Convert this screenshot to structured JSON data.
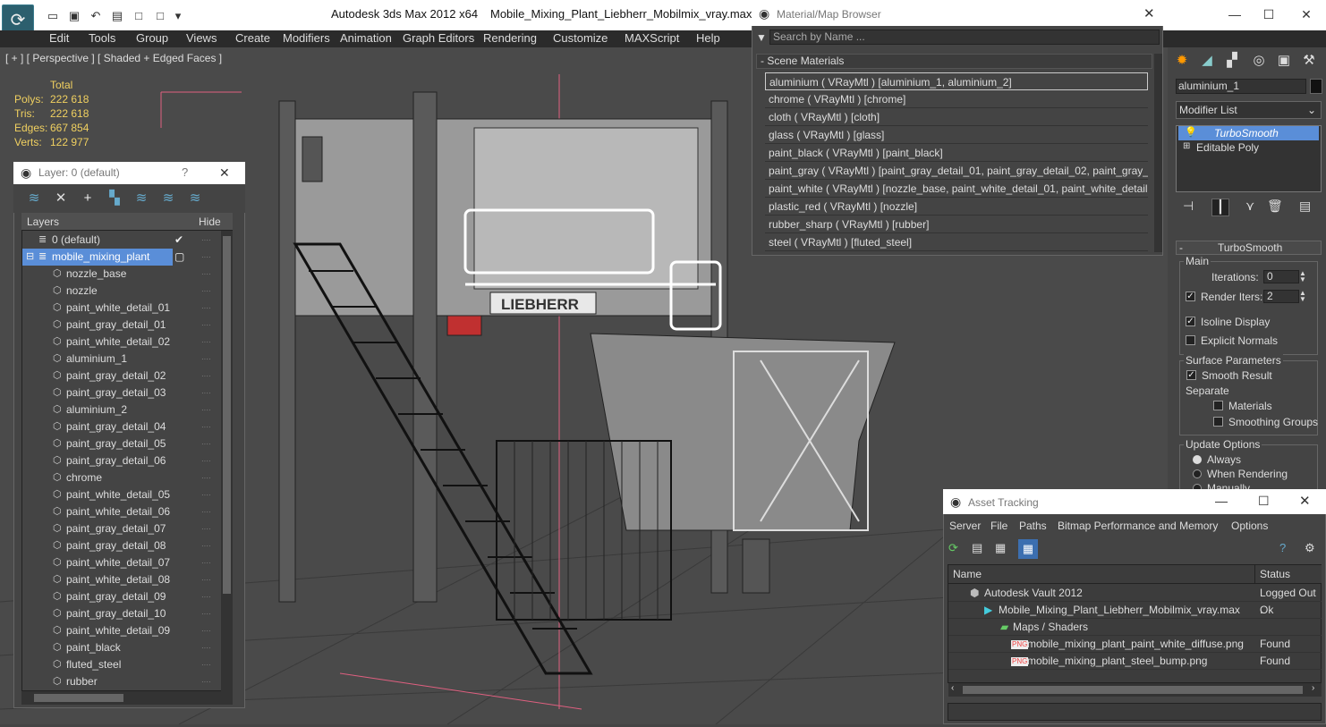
{
  "app": {
    "title": "Autodesk 3ds Max  2012 x64",
    "file": "Mobile_Mixing_Plant_Liebherr_Mobilmix_vray.max"
  },
  "menu": [
    "Edit",
    "Tools",
    "Group",
    "Views",
    "Create",
    "Modifiers",
    "Animation",
    "Graph Editors",
    "Rendering",
    "Customize",
    "MAXScript",
    "Help"
  ],
  "viewport": {
    "label": "[ + ] [ Perspective ] [ Shaded + Edged Faces ]",
    "stats": {
      "header": "Total",
      "rows": [
        {
          "label": "Polys:",
          "value": "222 618"
        },
        {
          "label": "Tris:",
          "value": "222 618"
        },
        {
          "label": "Edges:",
          "value": "667 854"
        },
        {
          "label": "Verts:",
          "value": "122 977"
        }
      ]
    },
    "sign": "LIEBHERR"
  },
  "layer": {
    "title": "Layer: 0 (default)",
    "help": "?",
    "close": "✕",
    "col_layers": "Layers",
    "col_hide": "Hide",
    "default": "0 (default)",
    "active": "mobile_mixing_plant",
    "items": [
      "nozzle_base",
      "nozzle",
      "paint_white_detail_01",
      "paint_gray_detail_01",
      "paint_white_detail_02",
      "aluminium_1",
      "paint_gray_detail_02",
      "paint_gray_detail_03",
      "aluminium_2",
      "paint_gray_detail_04",
      "paint_gray_detail_05",
      "paint_gray_detail_06",
      "chrome",
      "paint_white_detail_05",
      "paint_white_detail_06",
      "paint_gray_detail_07",
      "paint_gray_detail_08",
      "paint_white_detail_07",
      "paint_white_detail_08",
      "paint_gray_detail_09",
      "paint_gray_detail_10",
      "paint_white_detail_09",
      "paint_black",
      "fluted_steel",
      "rubber"
    ]
  },
  "material_browser": {
    "title": "Material/Map Browser",
    "search": "Search by Name ...",
    "section": "- Scene Materials",
    "items": [
      "aluminium  ( VRayMtl )  [aluminium_1, aluminium_2]",
      "chrome  ( VRayMtl )  [chrome]",
      "cloth  ( VRayMtl )  [cloth]",
      "glass  ( VRayMtl )  [glass]",
      "paint_black  ( VRayMtl )  [paint_black]",
      "paint_gray  ( VRayMtl )  [paint_gray_detail_01, paint_gray_detail_02, paint_gray_...",
      "paint_white  ( VRayMtl )  [nozzle_base, paint_white_detail_01, paint_white_detail...",
      "plastic_red  ( VRayMtl )  [nozzle]",
      "rubber_sharp  ( VRayMtl )  [rubber]",
      "steel  ( VRayMtl )  [fluted_steel]"
    ]
  },
  "command_panel": {
    "object_name": "aluminium_1",
    "modifier_list": "Modifier List",
    "stack": [
      "TurboSmooth",
      "Editable Poly"
    ],
    "rollout": "TurboSmooth",
    "main": "Main",
    "iterations_label": "Iterations:",
    "iterations": "0",
    "render_iters_label": "Render Iters:",
    "render_iters": "2",
    "isoline": "Isoline Display",
    "explicit": "Explicit Normals",
    "surface": "Surface Parameters",
    "smooth_result": "Smooth Result",
    "separate": "Separate",
    "materials": "Materials",
    "smoothing_groups": "Smoothing Groups",
    "update": "Update Options",
    "always": "Always",
    "when_rendering": "When Rendering",
    "manually": "Manually"
  },
  "asset_tracking": {
    "title": "Asset Tracking",
    "menu": [
      "Server",
      "File",
      "Paths",
      "Bitmap Performance and Memory",
      "Options"
    ],
    "col_name": "Name",
    "col_status": "Status",
    "rows": [
      {
        "name": "Autodesk Vault 2012",
        "status": "Logged Out ."
      },
      {
        "name": "Mobile_Mixing_Plant_Liebherr_Mobilmix_vray.max",
        "status": "Ok"
      },
      {
        "name": "Maps / Shaders",
        "status": ""
      },
      {
        "name": "mobile_mixing_plant_paint_white_diffuse.png",
        "status": "Found"
      },
      {
        "name": "mobile_mixing_plant_steel_bump.png",
        "status": "Found"
      }
    ]
  }
}
